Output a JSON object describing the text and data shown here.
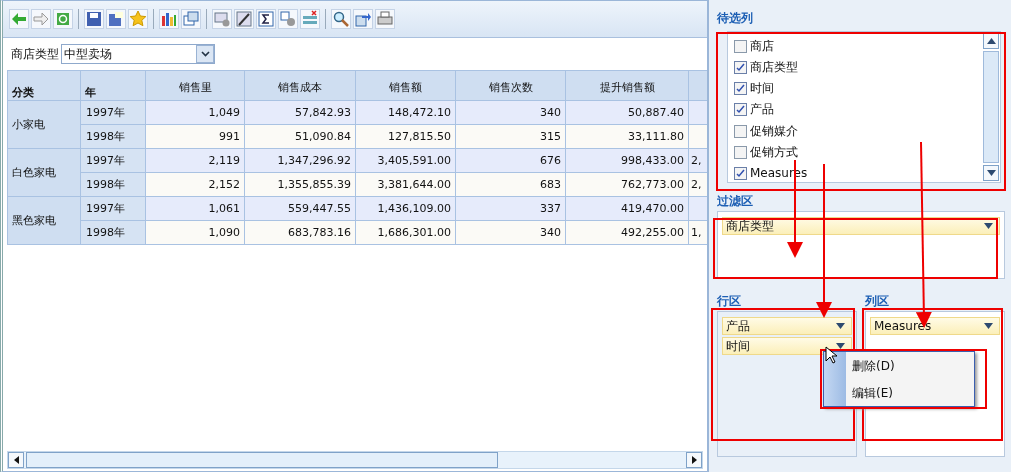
{
  "filter": {
    "label": "商店类型",
    "value": "中型卖场"
  },
  "table": {
    "columns": [
      "分类",
      "年",
      "销售里",
      "销售成本",
      "销售额",
      "销售次数",
      "提升销售额"
    ],
    "groups": [
      {
        "category": "小家电",
        "rows": [
          {
            "year": "1997年",
            "values": [
              "1,049",
              "57,842.93",
              "148,472.10",
              "340",
              "50,887.40"
            ]
          },
          {
            "year": "1998年",
            "values": [
              "991",
              "51,090.84",
              "127,815.50",
              "315",
              "33,111.80"
            ]
          }
        ]
      },
      {
        "category": "白色家电",
        "rows": [
          {
            "year": "1997年",
            "values": [
              "2,119",
              "1,347,296.92",
              "3,405,591.00",
              "676",
              "998,433.00"
            ],
            "column_8": "2,"
          },
          {
            "year": "1998年",
            "values": [
              "2,152",
              "1,355,855.39",
              "3,381,644.00",
              "683",
              "762,773.00"
            ],
            "column_8": "2,"
          }
        ]
      },
      {
        "category": "黑色家电",
        "rows": [
          {
            "year": "1997年",
            "values": [
              "1,061",
              "559,447.55",
              "1,436,109.00",
              "337",
              "419,470.00"
            ]
          },
          {
            "year": "1998年",
            "values": [
              "1,090",
              "683,783.16",
              "1,686,301.00",
              "340",
              "492,255.00"
            ],
            "column_8": "1,"
          }
        ]
      }
    ]
  },
  "available_columns": {
    "title": "待选列",
    "items": [
      {
        "label": "商店",
        "checked": false
      },
      {
        "label": "商店类型",
        "checked": true
      },
      {
        "label": "时间",
        "checked": true
      },
      {
        "label": "产品",
        "checked": true
      },
      {
        "label": "促销媒介",
        "checked": false
      },
      {
        "label": "促销方式",
        "checked": false
      },
      {
        "label": "Measures",
        "checked": true
      }
    ]
  },
  "filter_area": {
    "title": "过滤区",
    "fields": [
      "商店类型"
    ]
  },
  "row_area": {
    "title": "行区",
    "fields": [
      "产品",
      "时间"
    ]
  },
  "column_area": {
    "title": "列区",
    "fields": [
      "Measures"
    ]
  },
  "context_menu": {
    "items": [
      "删除(D)",
      "编辑(E)"
    ]
  }
}
